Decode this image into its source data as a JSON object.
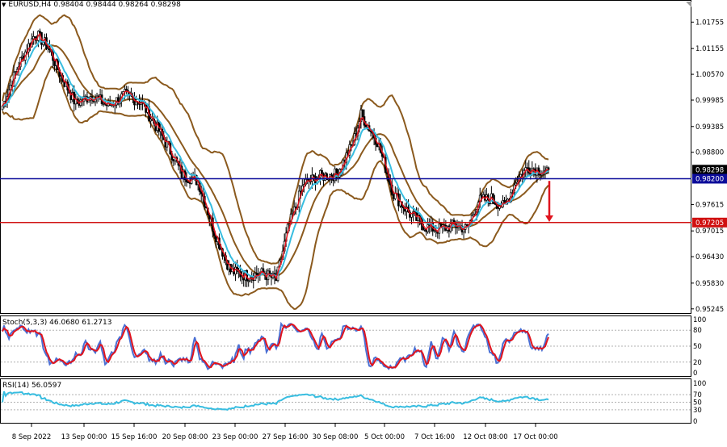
{
  "header": {
    "menu_icon": "triangle-down-icon",
    "symbol_tf": "EURUSD,H4",
    "ohlc": "0.98404 0.98444 0.98264 0.98298"
  },
  "colors": {
    "candles": "#000000",
    "fast_ma": "#e0141e",
    "slow_ma": "#38bde0",
    "bands": "#8b5a1e",
    "support_line": "#d01010",
    "resistance_line": "#0c0c9a",
    "stoch_k": "#4a6fd4",
    "stoch_d": "#e0141e",
    "rsi": "#38bde0",
    "arrow": "#e0141e",
    "current_price_tag": "#000000"
  },
  "price_axis": {
    "ticks": [
      "1.01755",
      "1.01155",
      "1.00570",
      "0.99985",
      "0.99385",
      "0.98800",
      "0.97615",
      "0.97015",
      "0.96430",
      "0.95830",
      "0.95245"
    ],
    "tick_values": [
      1.01755,
      1.01155,
      1.0057,
      0.99985,
      0.99385,
      0.988,
      0.97615,
      0.97015,
      0.9643,
      0.9583,
      0.95245
    ],
    "current_price_label": "0.98298",
    "level_labels": [
      "0.98200",
      "0.97205"
    ],
    "level_values": [
      0.982,
      0.97205
    ],
    "range": [
      0.9515,
      1.0222
    ]
  },
  "stoch": {
    "label": "Stoch(5,3,3) 46.0680 61.2713",
    "levels": [
      "100",
      "80",
      "50",
      "20",
      "0"
    ],
    "level_values": [
      100,
      80,
      50,
      20,
      0
    ]
  },
  "rsi": {
    "label": "RSI(14) 56.0597",
    "levels": [
      "100",
      "70",
      "50",
      "30",
      "0"
    ],
    "level_values": [
      100,
      70,
      50,
      30,
      0
    ]
  },
  "time_axis": {
    "labels": [
      "8 Sep 2022",
      "13 Sep 00:00",
      "15 Sep 16:00",
      "20 Sep 08:00",
      "23 Sep 00:00",
      "27 Sep 16:00",
      "30 Sep 08:00",
      "5 Oct 00:00",
      "7 Oct 16:00",
      "12 Oct 08:00",
      "17 Oct 00:00"
    ]
  },
  "chart_data": {
    "type": "candlestick",
    "symbol": "EURUSD",
    "timeframe": "H4",
    "anchors": [
      [
        0,
        0.9985
      ],
      [
        10,
        1.008
      ],
      [
        20,
        1.015
      ],
      [
        28,
        1.012
      ],
      [
        35,
        1.006
      ],
      [
        45,
        0.999
      ],
      [
        55,
        1.001
      ],
      [
        65,
        0.9985
      ],
      [
        75,
        1.001
      ],
      [
        85,
        0.9995
      ],
      [
        95,
        0.9935
      ],
      [
        105,
        0.987
      ],
      [
        110,
        0.983
      ],
      [
        120,
        0.9815
      ],
      [
        130,
        0.97
      ],
      [
        140,
        0.961
      ],
      [
        150,
        0.96
      ],
      [
        160,
        0.9605
      ],
      [
        168,
        0.959
      ],
      [
        175,
        0.9705
      ],
      [
        185,
        0.981
      ],
      [
        195,
        0.9825
      ],
      [
        205,
        0.983
      ],
      [
        215,
        0.99
      ],
      [
        220,
        0.9965
      ],
      [
        230,
        0.9905
      ],
      [
        240,
        0.9785
      ],
      [
        250,
        0.974
      ],
      [
        260,
        0.971
      ],
      [
        268,
        0.9705
      ],
      [
        278,
        0.9715
      ],
      [
        285,
        0.9705
      ],
      [
        292,
        0.977
      ],
      [
        300,
        0.9775
      ],
      [
        308,
        0.9755
      ],
      [
        315,
        0.9815
      ],
      [
        322,
        0.9845
      ],
      [
        330,
        0.984
      ],
      [
        335,
        0.983
      ]
    ],
    "forecast_arrow": {
      "from": 0.9815,
      "to": 0.9722
    }
  }
}
